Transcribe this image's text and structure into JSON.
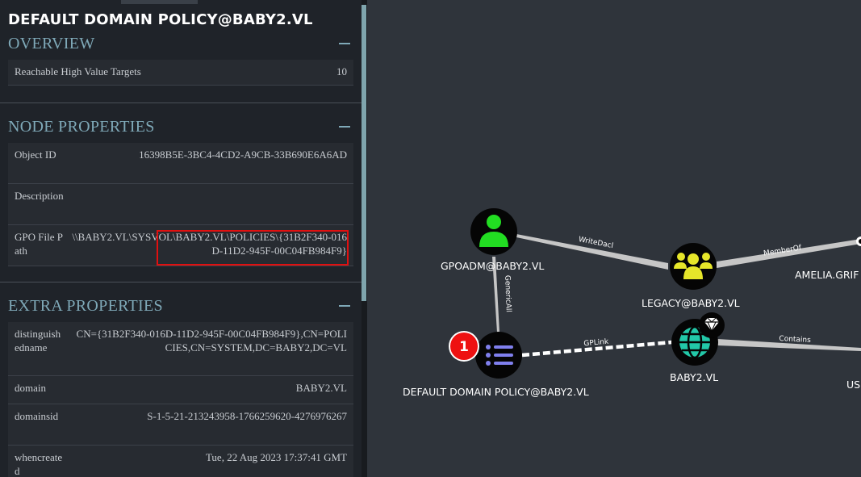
{
  "node_title": "DEFAULT DOMAIN POLICY@BABY2.VL",
  "overview": {
    "heading": "OVERVIEW",
    "rows": [
      {
        "key": "Reachable High Value Targets",
        "value": "10"
      }
    ]
  },
  "node_properties": {
    "heading": "NODE PROPERTIES",
    "rows": [
      {
        "key": "Object ID",
        "value": "16398B5E-3BC4-4CD2-A9CB-33B690E6A6AD"
      },
      {
        "key": "Description",
        "value": ""
      },
      {
        "key": "GPO File Path",
        "value": "\\\\BABY2.VL\\SYSVOL\\BABY2.VL\\POLICIES\\{31B2F340-016D-11D2-945F-00C04FB984F9}"
      }
    ]
  },
  "extra_properties": {
    "heading": "EXTRA PROPERTIES",
    "rows": [
      {
        "key": "distinguishedname",
        "value": "CN={31B2F340-016D-11D2-945F-00C04FB984F9},CN=POLICIES,CN=SYSTEM,DC=BABY2,DC=VL"
      },
      {
        "key": "domain",
        "value": "BABY2.VL"
      },
      {
        "key": "domainsid",
        "value": "S-1-5-21-213243958-1766259620-4276976267"
      },
      {
        "key": "whencreated",
        "value": "Tue, 22 Aug 2023 17:37:41 GMT"
      }
    ]
  },
  "graph": {
    "nodes": {
      "gpoadm": {
        "label": "GPOADM@BABY2.VL",
        "icon": "user-icon",
        "color": "#22dd22"
      },
      "legacy": {
        "label": "LEGACY@BABY2.VL",
        "icon": "group-icon",
        "color": "#e6e62a"
      },
      "amelia": {
        "label": "AMELIA.GRIF"
      },
      "gpo": {
        "label": "DEFAULT DOMAIN POLICY@BABY2.VL",
        "icon": "gpo-list-icon",
        "color": "#8080ee",
        "badge": "1"
      },
      "domain": {
        "label": "BABY2.VL",
        "icon": "globe-icon",
        "color": "#22c8a8"
      },
      "users": {
        "label": "US"
      }
    },
    "edges": {
      "writedacl": "WriteDacl",
      "memberof": "MemberOf",
      "genericall": "GenericAll",
      "gplink": "GPLink",
      "contains": "Contains"
    }
  },
  "colors": {
    "panel_bg": "#1f2329",
    "graph_bg": "#2f343b",
    "section_heading": "#7fa9b8",
    "highlight": "#e01010",
    "badge": "#ee1111"
  }
}
